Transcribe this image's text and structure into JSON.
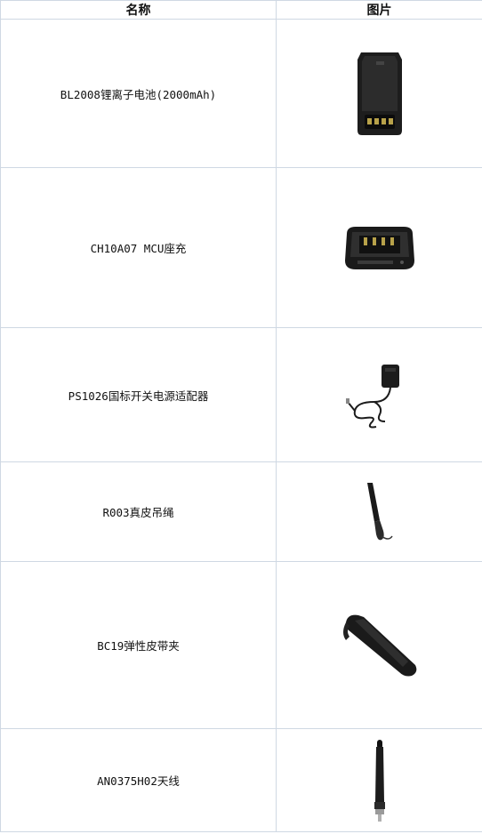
{
  "table": {
    "headers": [
      "名称",
      "图片"
    ],
    "rows": [
      {
        "name": "BL2008锂离子电池(2000mAh)",
        "image": "battery-image"
      },
      {
        "name": "CH10A07 MCU座充",
        "image": "charger-image"
      },
      {
        "name": "PS1026国标开关电源适配器",
        "image": "adapter-image"
      },
      {
        "name": "R003真皮吊绳",
        "image": "strap-image"
      },
      {
        "name": "BC19弹性皮带夹",
        "image": "belt-clip-image"
      },
      {
        "name": "AN0375H02天线",
        "image": "antenna-image"
      }
    ]
  }
}
